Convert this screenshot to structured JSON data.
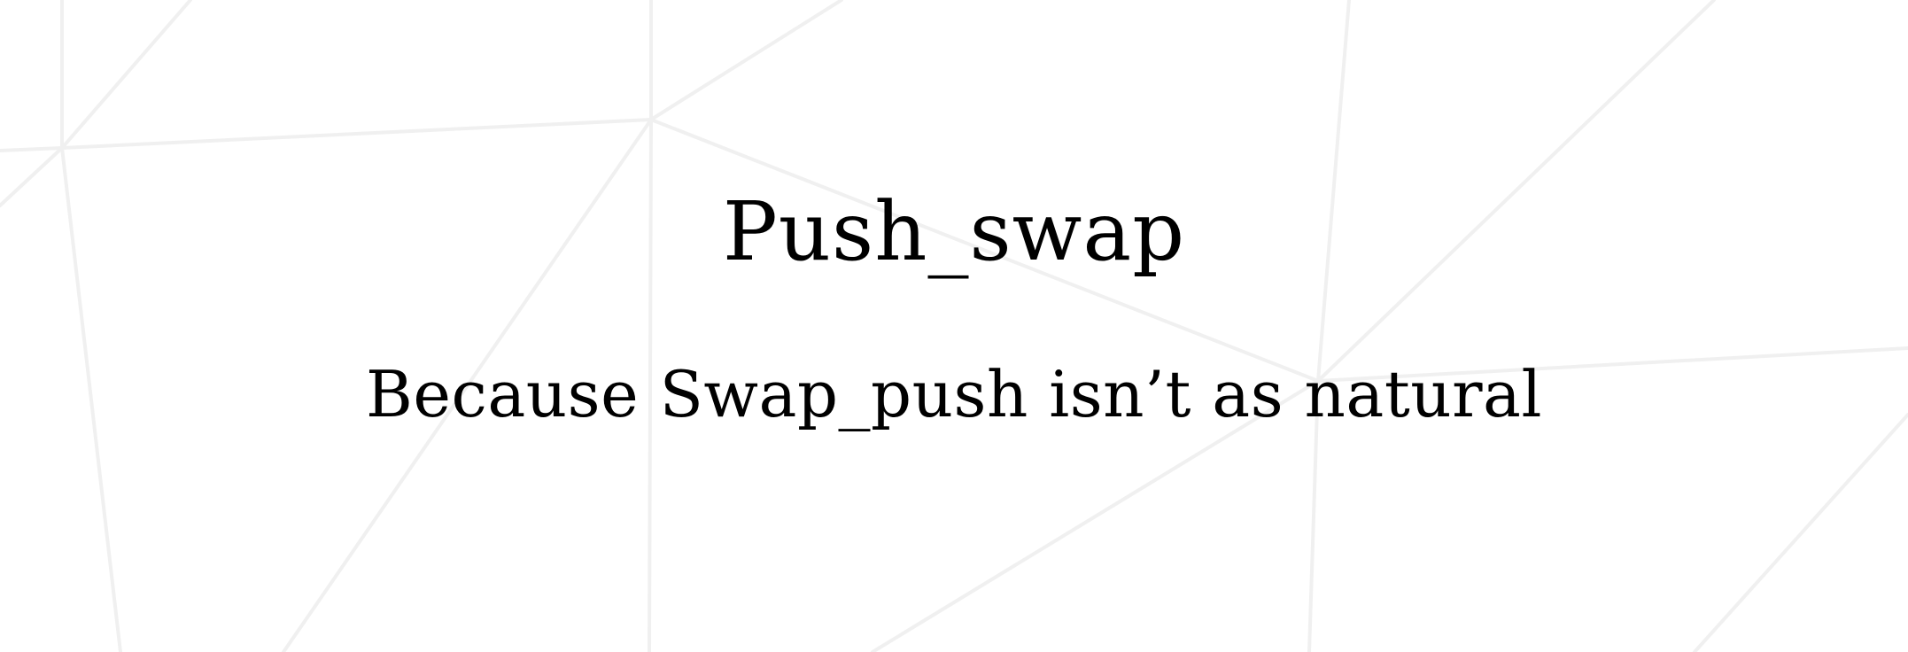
{
  "document": {
    "title": "Push_swap",
    "subtitle": "Because Swap_push isn’t as natural"
  }
}
